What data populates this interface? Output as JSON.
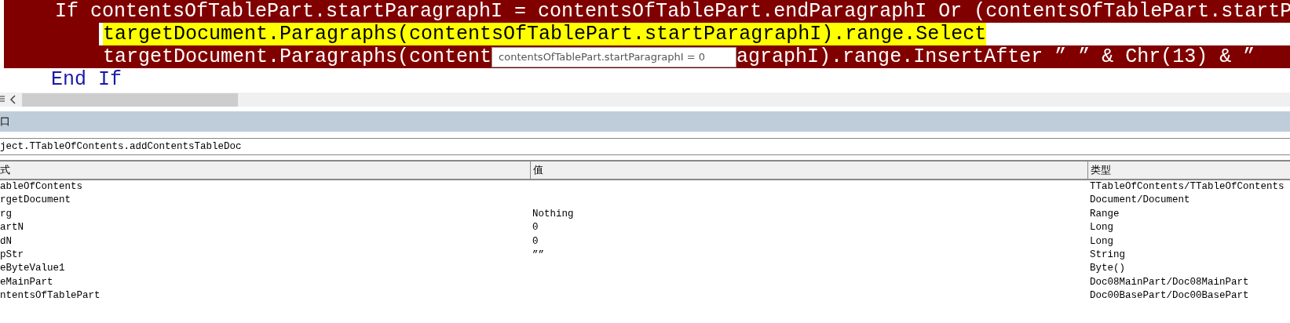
{
  "code_lines": [
    {
      "kind": "breakpoint",
      "indented": false,
      "parts": [
        "If contentsOfTablePart.startParagraphI = contentsOfTablePart.endParagraphI Or (contentsOfTablePart.startP"
      ]
    },
    {
      "kind": "current",
      "indented": true,
      "parts": [
        "targetDocument.Paragraphs(contentsOfTablePart.startParagraphI).range.Select"
      ]
    },
    {
      "kind": "breakpoint",
      "indented": true,
      "parts": [
        "targetDocument.Paragraphs(content",
        "agraphI).range.InsertAfter ” ” & Chr(13) & ”"
      ],
      "tooltip": "contentsOfTablePart.startParagraphI = 0"
    },
    {
      "kind": "normal",
      "indented": false,
      "parts": [
        "End If"
      ]
    }
  ],
  "locals_window": {
    "title": "口",
    "context": "ject.TTableOfContents.addContentsTableDoc",
    "columns": [
      "式",
      "值",
      "类型"
    ],
    "rows": [
      {
        "name": "ableOfContents",
        "type": "TTableOfContents/TTableOfContents"
      },
      {
        "name": "rgetDocument",
        "type": "Document/Document"
      },
      {
        "name": "rg",
        "value": "Nothing",
        "type": "Range"
      },
      {
        "name": "artN",
        "value": "0",
        "type": "Long"
      },
      {
        "name": "dN",
        "value": "0",
        "type": "Long"
      },
      {
        "name": "pStr",
        "value": "””",
        "type": "String"
      },
      {
        "name": "eByteValue1",
        "type": "Byte()"
      },
      {
        "name": "eMainPart",
        "type": "Doc08MainPart/Doc08MainPart"
      },
      {
        "name": "ntentsOfTablePart",
        "type": "Doc00BasePart/Doc00BasePart"
      }
    ]
  }
}
